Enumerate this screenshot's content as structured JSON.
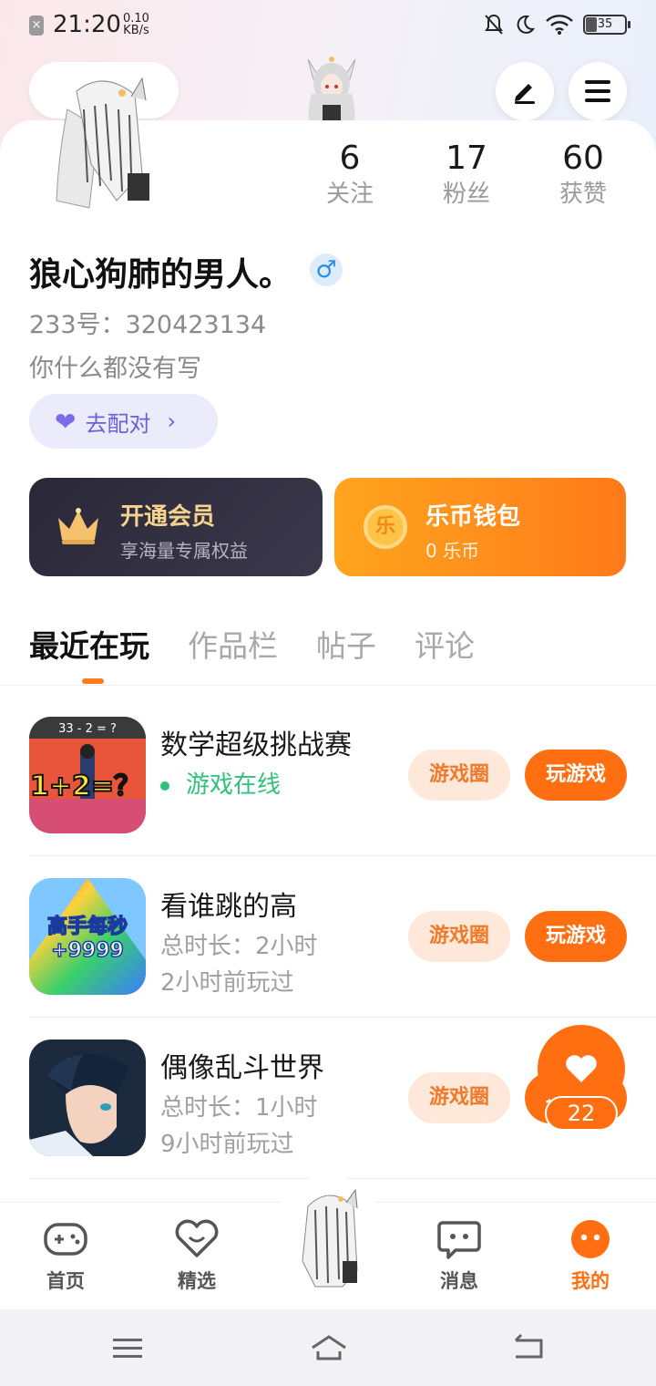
{
  "status_bar": {
    "time": "21:20",
    "net_speed_value": "0.10",
    "net_speed_unit": "KB/s",
    "battery": "35",
    "icons": [
      "mute-bell-icon",
      "moon-icon",
      "wifi-icon",
      "battery-icon"
    ]
  },
  "header": {
    "top_left_pill": "",
    "edit_icon": "edit-icon",
    "menu_icon": "menu-icon"
  },
  "profile": {
    "stats": [
      {
        "num": "6",
        "label": "关注"
      },
      {
        "num": "17",
        "label": "粉丝"
      },
      {
        "num": "60",
        "label": "获赞"
      }
    ],
    "name": "狼心狗肺的男人。",
    "gender_symbol": "♂",
    "uid": "233号：320423134",
    "bio": "你什么都没有写",
    "match_label": "去配对"
  },
  "cards": {
    "vip_title": "开通会员",
    "vip_sub": "享海量专属权益",
    "wallet_title": "乐币钱包",
    "wallet_sub": "0 乐币",
    "wallet_coin_glyph": "乐"
  },
  "tabs": [
    "最近在玩",
    "作品栏",
    "帖子",
    "评论"
  ],
  "games": [
    {
      "name": "数学超级挑战赛",
      "status": "游戏在线",
      "circle_label": "游戏圈",
      "play_label": "玩游戏",
      "thumb_text": "1+2=？",
      "thumb_top": "33 - 2 = ?"
    },
    {
      "name": "看谁跳的高",
      "duration": "总时长：2小时",
      "last_played": "2小时前玩过",
      "circle_label": "游戏圈",
      "play_label": "玩游戏",
      "thumb_text1": "高手每秒",
      "thumb_text2": "+9999"
    },
    {
      "name": "偶像乱斗世界",
      "duration": "总时长：1小时",
      "last_played": "9小时前玩过",
      "circle_label": "游戏圈",
      "play_label": "玩游戏"
    }
  ],
  "float_like": {
    "count": "22"
  },
  "bottom_nav": [
    {
      "label": "首页",
      "icon": "gamepad-icon"
    },
    {
      "label": "精选",
      "icon": "heart-smile-icon"
    },
    {
      "label": "",
      "icon": "avatar-center"
    },
    {
      "label": "消息",
      "icon": "chat-icon"
    },
    {
      "label": "我的",
      "icon": "me-icon"
    }
  ],
  "colors": {
    "accent": "#ff6f12",
    "vip_bg": "#2a2838",
    "match_bg": "#ecebfb",
    "online": "#2fc27a"
  }
}
